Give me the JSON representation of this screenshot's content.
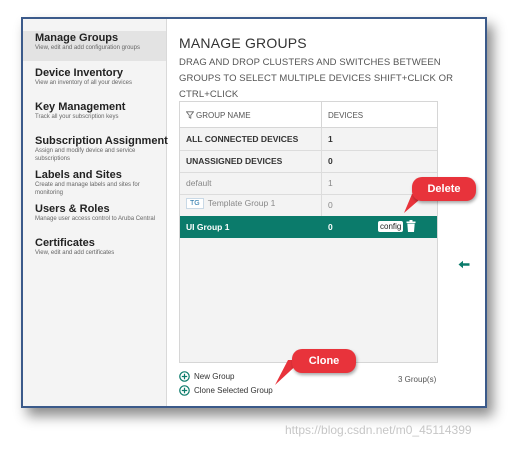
{
  "sidebar": {
    "items": [
      {
        "title": "Manage Groups",
        "desc": "View, edit and add configuration groups"
      },
      {
        "title": "Device Inventory",
        "desc": "View an inventory of all your devices"
      },
      {
        "title": "Key Management",
        "desc": "Track all your subscription keys"
      },
      {
        "title": "Subscription Assignment",
        "desc": "Assign and modify device and service subscriptions"
      },
      {
        "title": "Labels and Sites",
        "desc": "Create and manage labels and sites for monitoring"
      },
      {
        "title": "Users & Roles",
        "desc": "Manage user access control to Aruba Central"
      },
      {
        "title": "Certificates",
        "desc": "View, edit and add certificates"
      }
    ]
  },
  "main": {
    "title": "MANAGE GROUPS",
    "instructions": "DRAG AND DROP CLUSTERS AND SWITCHES BETWEEN GROUPS TO SELECT MULTIPLE DEVICES SHIFT+CLICK OR CTRL+CLICK"
  },
  "table": {
    "headers": {
      "name": "GROUP NAME",
      "devices": "DEVICES"
    },
    "rows": [
      {
        "name": "ALL CONNECTED DEVICES",
        "devices": "1"
      },
      {
        "name": "UNASSIGNED DEVICES",
        "devices": "0"
      },
      {
        "name": "default",
        "devices": "1"
      },
      {
        "badge": "TG",
        "name": "Template Group 1",
        "devices": "0"
      },
      {
        "name": "UI Group 1",
        "devices": "0",
        "config": "config"
      }
    ]
  },
  "footer": {
    "new_group": "New Group",
    "clone_group": "Clone Selected Group",
    "group_count": "3 Group(s)"
  },
  "callouts": {
    "delete": "Delete",
    "clone": "Clone"
  },
  "watermark": "https://blog.csdn.net/m0_45114399",
  "colors": {
    "accent": "#0b7b6b",
    "callout": "#e8333b",
    "frame": "#3b5a8a"
  },
  "icons": [
    "filter-icon",
    "trash-icon",
    "plus-circle-icon",
    "back-arrow-icon"
  ]
}
